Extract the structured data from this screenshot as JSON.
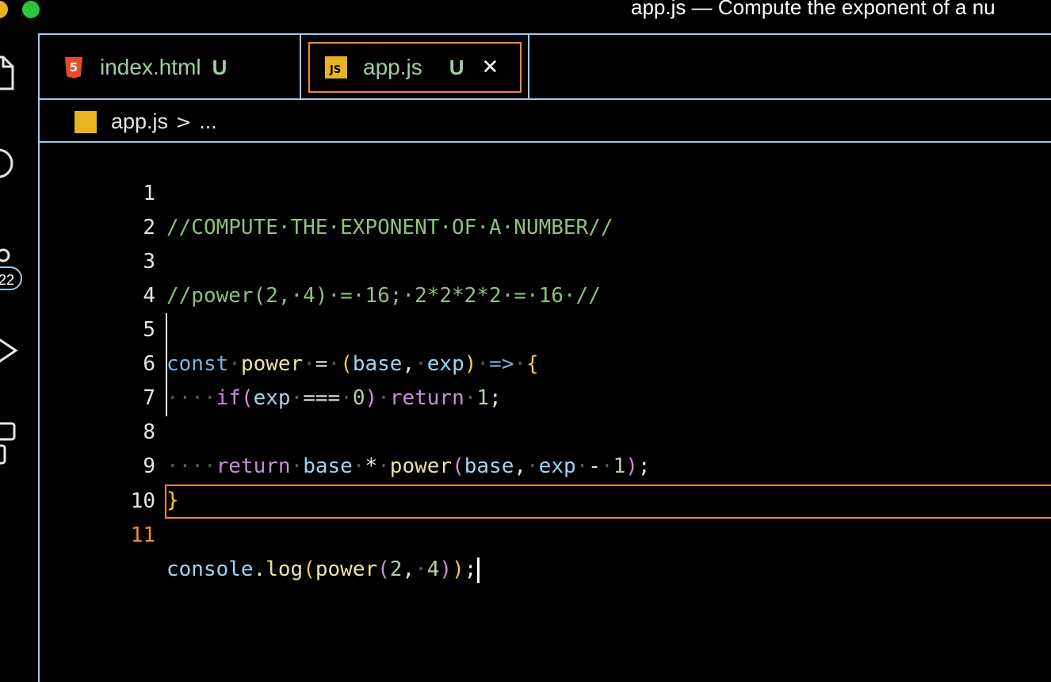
{
  "window": {
    "title": "app.js — Compute the exponent of a nu"
  },
  "activity_bar": {
    "icons": [
      "files-icon",
      "search-icon",
      "source-control-icon",
      "run-debug-icon",
      "extensions-icon"
    ],
    "source_control_badge": "22"
  },
  "tabs": [
    {
      "label": "index.html",
      "status": "U",
      "icon": "html5-icon",
      "active": false
    },
    {
      "label": "app.js",
      "status": "U",
      "icon": "js-icon",
      "active": true,
      "close": "✕"
    }
  ],
  "breadcrumb": {
    "file": "app.js",
    "separator": ">",
    "rest": "..."
  },
  "colors": {
    "accent": "#f08a3e",
    "border": "#9ec9e6",
    "comment": "#8fbf7f",
    "keyword": "#7fb0e0",
    "control": "#c58fd6",
    "function": "#e8e4a8",
    "variable": "#9fd4f0",
    "number": "#b5cea8",
    "brace": "#f5cc3a"
  },
  "editor": {
    "active_line": 11,
    "line_numbers": [
      "1",
      "2",
      "3",
      "4",
      "5",
      "6",
      "7",
      "8",
      "9",
      "10",
      "11"
    ],
    "lines": {
      "l1": "//COMPUTE·THE·EXPONENT·OF·A·NUMBER//",
      "l3": "//power(2,·4)·=·16;·2*2*2*2·=·16·//",
      "l5": {
        "kw": "const",
        "name": "power",
        "eq": "=",
        "open": "(",
        "p1": "base",
        "comma": ",",
        "p2": "exp",
        "close": ")",
        "arrow": "=>",
        "brace": "{"
      },
      "l6": {
        "indent": "····",
        "kw": "if",
        "open": "(",
        "var": "exp",
        "op": "===",
        "num": "0",
        "close": ")",
        "ret": "return",
        "val": "1",
        "semi": ";"
      },
      "l8": {
        "indent": "····",
        "ret": "return",
        "var": "base",
        "op": "*",
        "fn": "power",
        "open": "(",
        "a1": "base",
        "comma": ",",
        "a2": "exp",
        "minus": "-",
        "num": "1",
        "close": ")",
        "semi": ";"
      },
      "l9": "}",
      "l11": {
        "obj": "console",
        "dot": ".",
        "method": "log",
        "open1": "(",
        "fn": "power",
        "open2": "(",
        "n1": "2",
        "comma": ",",
        "n2": "4",
        "close2": ")",
        "close1": ")",
        "semi": ";"
      }
    }
  }
}
